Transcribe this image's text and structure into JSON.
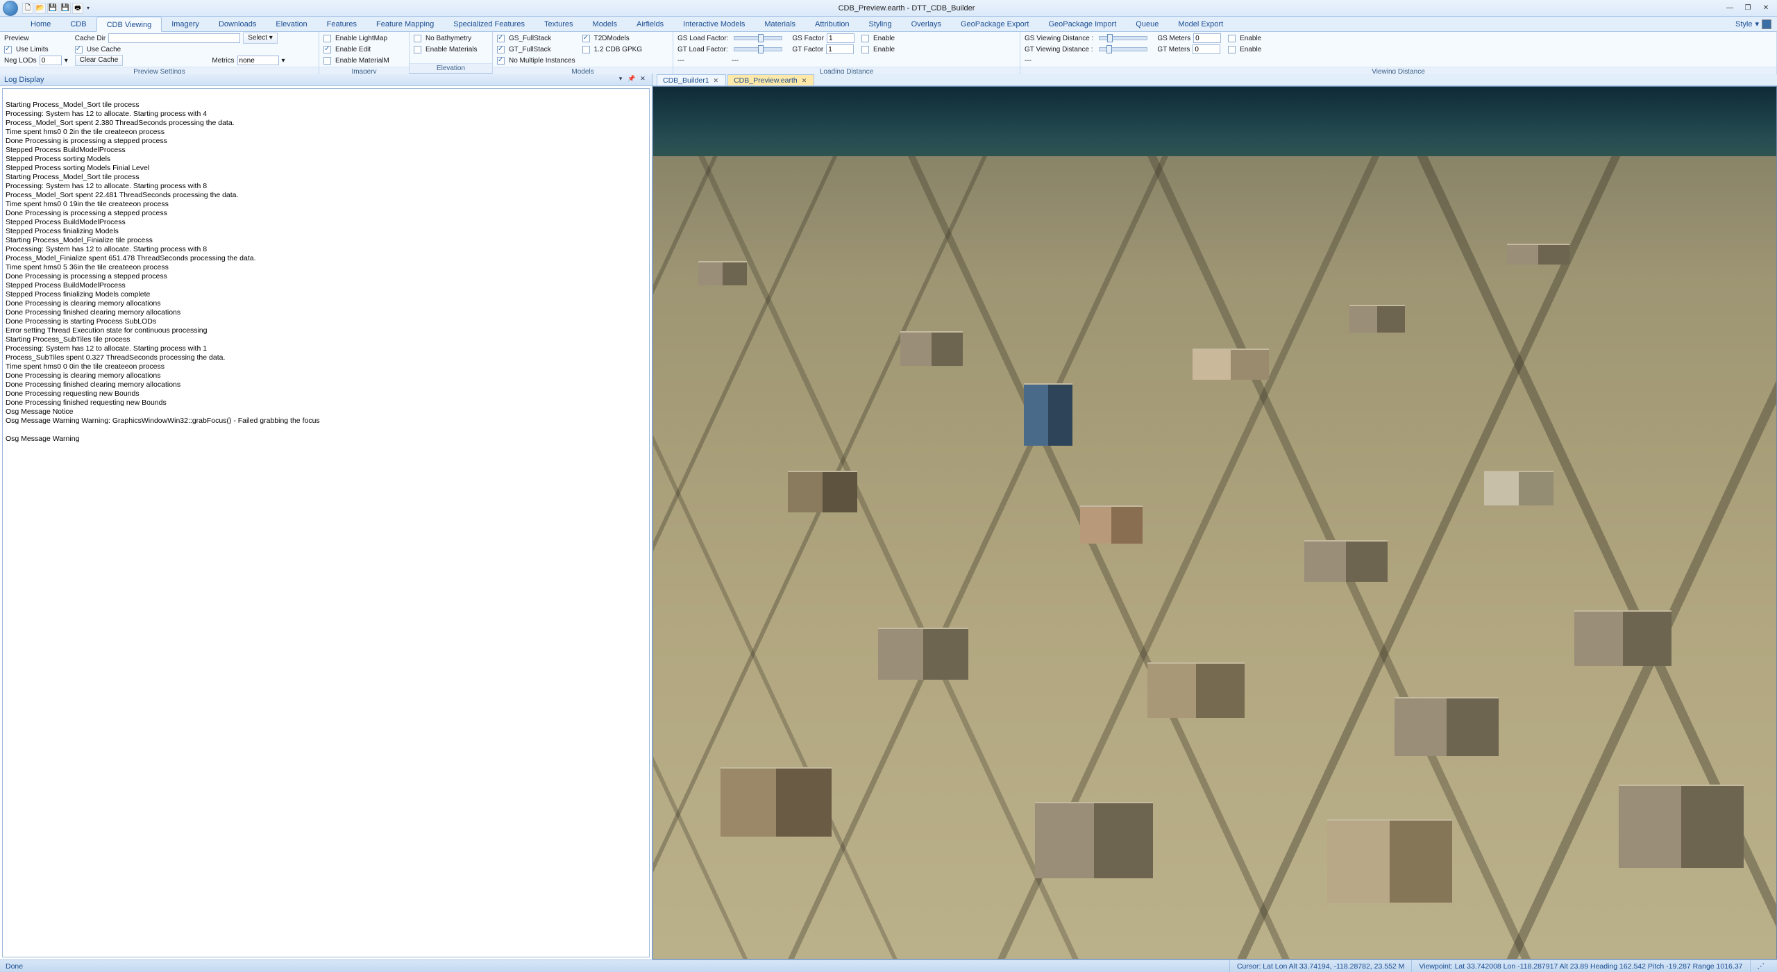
{
  "title": "CDB_Preview.earth - DTT_CDB_Builder",
  "qat": [
    "🗋",
    "📂",
    "💾",
    "💾",
    "🖶"
  ],
  "winctl": {
    "min": "—",
    "max": "❐",
    "close": "✕"
  },
  "style_label": "Style",
  "tabs": [
    "Home",
    "CDB",
    "CDB Viewing",
    "Imagery",
    "Downloads",
    "Elevation",
    "Features",
    "Feature Mapping",
    "Specialized Features",
    "Textures",
    "Models",
    "Airfields",
    "Interactive Models",
    "Materials",
    "Attribution",
    "Styling",
    "Overlays",
    "GeoPackage Export",
    "GeoPackage Import",
    "Queue",
    "Model Export"
  ],
  "active_tab": 2,
  "ribbon": {
    "preview": {
      "title": "Preview Settings",
      "preview": "Preview",
      "cache_dir": "Cache Dir",
      "cache_dir_val": "",
      "select": "Select",
      "use_limits": "Use Limits",
      "use_cache": "Use Cache",
      "neg_lods": "Neg LODs",
      "neg_lods_val": "0",
      "clear_cache": "Clear Cache",
      "metrics": "Metrics",
      "metrics_val": "none"
    },
    "imagery": {
      "title": "Imagery",
      "enable_lightmap": "Enable LightMap",
      "enable_edit": "Enable Edit",
      "enable_materialm": "Enable MaterialM"
    },
    "elevation": {
      "title": "Elevation",
      "no_bathymetry": "No Bathymetry",
      "enable_materials": "Enable Materials"
    },
    "models": {
      "title": "Models",
      "gs_fullstack": "GS_FullStack",
      "gt_fullstack": "GT_FullStack",
      "no_multi": "No Multiple Instances",
      "t2dmodels": "T2DModels",
      "cdb_gpkg": "1.2 CDB GPKG"
    },
    "loading": {
      "title": "Loading Distance",
      "gs_load": "GS Load Factor:",
      "gt_load": "GT Load Factor:",
      "gs_factor": "GS Factor",
      "gs_factor_val": "1",
      "gt_factor": "GT Factor",
      "gt_factor_val": "1",
      "enable": "Enable",
      "dots": "---"
    },
    "viewing": {
      "title": "Viewing Distance",
      "gs_view": "GS Viewing Distance :",
      "gt_view": "GT Viewing Distance :",
      "gs_meters": "GS Meters",
      "gs_meters_val": "0",
      "gt_meters": "GT Meters",
      "gt_meters_val": "0",
      "enable": "Enable"
    }
  },
  "log_panel": {
    "title": "Log Display",
    "pin": "📌",
    "close": "✕"
  },
  "log_lines": [
    "",
    "Starting Process_Model_Sort tile process",
    "Processing: System has 12 to allocate. Starting process with 4",
    "Process_Model_Sort spent 2.380 ThreadSeconds processing the data.",
    "Time spent hms0 0 2in the tile createeon process",
    "Done Processing is processing a stepped process",
    "Stepped Process BuildModelProcess",
    "Stepped Process sorting Models",
    "Stepped Process sorting Models Finial Level",
    "Starting Process_Model_Sort tile process",
    "Processing: System has 12 to allocate. Starting process with 8",
    "Process_Model_Sort spent 22.481 ThreadSeconds processing the data.",
    "Time spent hms0 0 19in the tile createeon process",
    "Done Processing is processing a stepped process",
    "Stepped Process BuildModelProcess",
    "Stepped Process finializing Models",
    "Starting Process_Model_Finialize tile process",
    "Processing: System has 12 to allocate. Starting process with 8",
    "Process_Model_Finialize spent 651.478 ThreadSeconds processing the data.",
    "Time spent hms0 5 36in the tile createeon process",
    "Done Processing is processing a stepped process",
    "Stepped Process BuildModelProcess",
    "Stepped Process finializing Models complete",
    "Done Processing is clearing memory allocations",
    "Done Processing finished clearing memory allocations",
    "Done Processing is starting Process SubLODs",
    "Error setting Thread Execution state for continuous processing",
    "Starting Process_SubTiles tile process",
    "Processing: System has 12 to allocate. Starting process with 1",
    "Process_SubTiles spent 0.327 ThreadSeconds processing the data.",
    "Time spent hms0 0 0in the tile createeon process",
    "Done Processing is clearing memory allocations",
    "Done Processing finished clearing memory allocations",
    "Done Processing requesting new Bounds",
    "Done Processing finished requesting new Bounds",
    "Osg Message Notice",
    "Osg Message Warning Warning: GraphicsWindowWin32::grabFocus() - Failed grabbing the focus",
    "",
    "Osg Message Warning"
  ],
  "doc_tabs": [
    {
      "label": "CDB_Builder1",
      "active": false
    },
    {
      "label": "CDB_Preview.earth",
      "active": true
    }
  ],
  "status": {
    "done": "Done",
    "cursor": "Cursor: Lat Lon Alt 33.74194, -118.28782, 23.552 M",
    "viewpoint": "Viewpoint: Lat 33.742008 Lon -118.287917 Alt      23.89 Heading 162.542 Pitch -19.287 Range    1016.37"
  }
}
